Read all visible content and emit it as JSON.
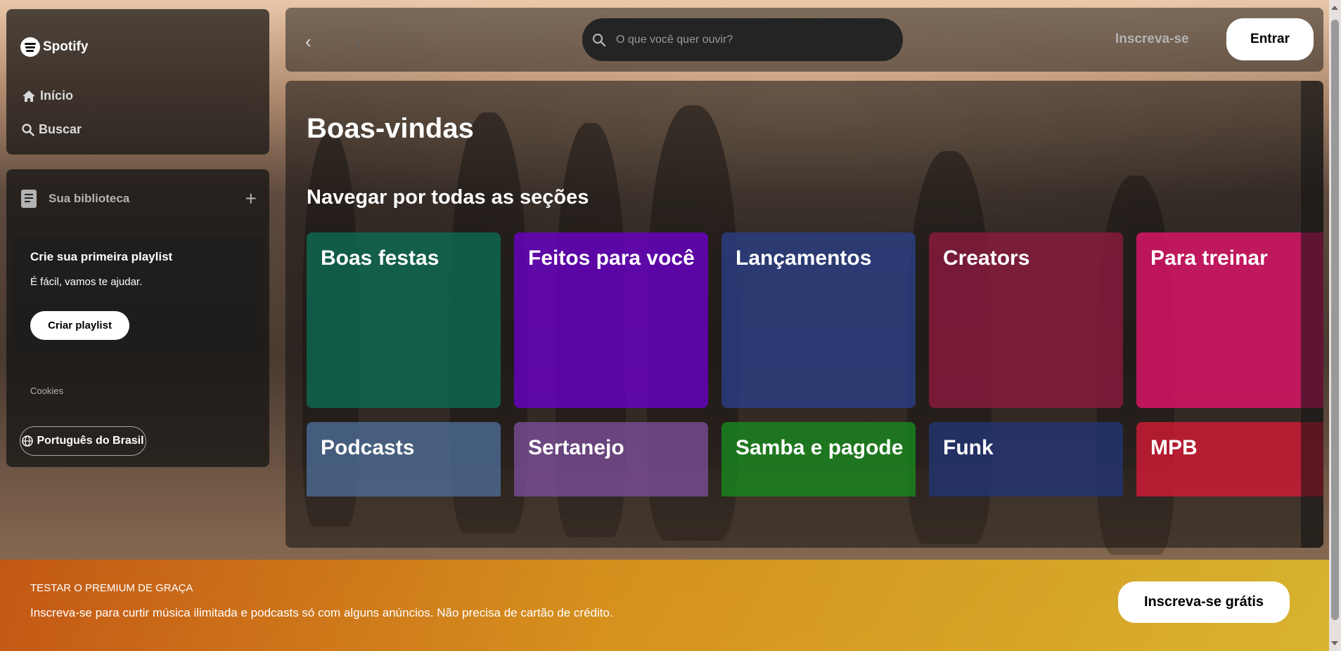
{
  "app": {
    "name": "Spotify"
  },
  "sidebar": {
    "nav": [
      {
        "label": "Início",
        "icon": "home-icon"
      },
      {
        "label": "Buscar",
        "icon": "search-icon"
      }
    ],
    "library": {
      "title": "Sua biblioteca",
      "card": {
        "title": "Crie sua primeira playlist",
        "subtitle": "É fácil, vamos te ajudar.",
        "button": "Criar playlist"
      },
      "cookies": "Cookies",
      "language": "Português do Brasil"
    }
  },
  "topbar": {
    "search_placeholder": "O que você quer ouvir?",
    "signup": "Inscreva-se",
    "login": "Entrar"
  },
  "main": {
    "welcome": "Boas-vindas",
    "browse_title": "Navegar por todas as seções",
    "tiles": [
      {
        "label": "Boas festas",
        "color": "#0d6b52"
      },
      {
        "label": "Feitos para você",
        "color": "#6a00c8"
      },
      {
        "label": "Lançamentos",
        "color": "#2a3f86"
      },
      {
        "label": "Creators",
        "color": "#8c1a3e"
      },
      {
        "label": "Para treinar",
        "color": "#e3146a"
      },
      {
        "label": "Podcasts",
        "color": "#4c6c96"
      },
      {
        "label": "Sertanejo",
        "color": "#7a4d96"
      },
      {
        "label": "Samba e pagode",
        "color": "#188a1e"
      },
      {
        "label": "Funk",
        "color": "#233574"
      },
      {
        "label": "MPB",
        "color": "#d41a36"
      }
    ]
  },
  "banner": {
    "kicker": "TESTAR O PREMIUM DE GRAÇA",
    "text": "Inscreva-se para curtir música ilimitada e podcasts só com alguns anúncios. Não precisa de cartão de crédito.",
    "button": "Inscreva-se grátis"
  }
}
